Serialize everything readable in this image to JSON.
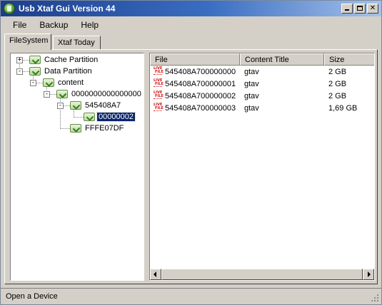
{
  "window": {
    "title": "Usb Xtaf Gui Version 44",
    "icon": "app-shield-icon",
    "controls": [
      "minimize-icon",
      "maximize-icon",
      "close-icon"
    ]
  },
  "menu": {
    "items": [
      "File",
      "Backup",
      "Help"
    ]
  },
  "tabs": [
    {
      "label": "FileSystem",
      "active": true
    },
    {
      "label": "Xtaf Today",
      "active": false
    }
  ],
  "tree": {
    "nodes": [
      {
        "label": "Cache Partition",
        "expander": "+"
      },
      {
        "label": "Data Partition",
        "expander": "-"
      },
      {
        "label": "content",
        "expander": "-"
      },
      {
        "label": "0000000000000000",
        "expander": "-"
      },
      {
        "label": "545408A7",
        "expander": "-"
      },
      {
        "label": "00000002",
        "selected": true
      },
      {
        "label": "FFFE07DF"
      }
    ]
  },
  "list": {
    "columns": [
      "File",
      "Content Title",
      "Size"
    ],
    "row_icon": {
      "name": "live-file-icon",
      "text_top": "LIVE",
      "text_bottom": "FILE",
      "color": "#d01818"
    },
    "rows": [
      {
        "file": "545408A700000000",
        "title": "gtav",
        "size": "2 GB"
      },
      {
        "file": "545408A700000001",
        "title": "gtav",
        "size": "2 GB"
      },
      {
        "file": "545408A700000002",
        "title": "gtav",
        "size": "2 GB"
      },
      {
        "file": "545408A700000003",
        "title": "gtav",
        "size": "1,69 GB"
      }
    ]
  },
  "status": {
    "text": "Open a Device"
  },
  "colors": {
    "titlebar_start": "#1c3d8c",
    "titlebar_end": "#a6c2ea",
    "selection": "#0a246a",
    "chrome": "#d4d0c8"
  }
}
